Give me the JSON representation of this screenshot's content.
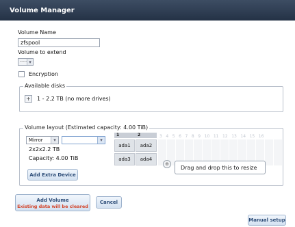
{
  "window": {
    "title": "Volume Manager"
  },
  "volume_name": {
    "label": "Volume Name",
    "value": "zfspool"
  },
  "volume_to_extend": {
    "label": "Volume to extend",
    "value": "-----"
  },
  "encryption": {
    "label": "Encryption",
    "checked": false
  },
  "available_disks": {
    "legend": "Available disks",
    "toggle": "+",
    "entry": "1 - 2.2 TB (no more drives)"
  },
  "volume_layout": {
    "legend": "Volume layout (Estimated capacity: 4.00 TiB)",
    "layout_select": "Mirror",
    "size_text": "2x2x2.2 TB",
    "capacity_text": "Capacity: 4.00 TiB",
    "add_extra_device": "Add Extra Device",
    "column_headers": [
      "1",
      "2"
    ],
    "faded_columns": [
      "3",
      "4",
      "5",
      "6",
      "7",
      "8",
      "9",
      "10",
      "11",
      "12",
      "13",
      "14",
      "15",
      "16"
    ],
    "rows": [
      [
        "ada1",
        "ada2"
      ],
      [
        "ada3",
        "ada4"
      ]
    ],
    "resize_hint": "Drag and drop this to resize"
  },
  "buttons": {
    "add_volume": "Add Volume",
    "add_volume_warning": "Existing data will be cleared",
    "cancel": "Cancel",
    "manual_setup": "Manual setup"
  },
  "colors": {
    "title_bar": "#2e3d52",
    "warning": "#d4452b",
    "button_text": "#2d4d78"
  }
}
